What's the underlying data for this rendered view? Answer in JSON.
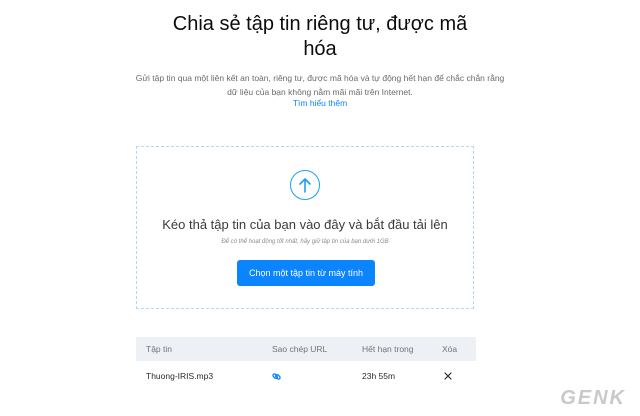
{
  "page": {
    "title": "Chia sẻ tập tin riêng tư, được mã hóa",
    "description": "Gửi tập tin qua một liên kết an toàn, riêng tư, được mã hóa và tự động hết hạn để chắc chắn rằng dữ liệu của bạn không nằm mãi mãi trên Internet.",
    "learn_more": "Tìm hiểu thêm"
  },
  "upload": {
    "icon": "upload-arrow-icon",
    "drop_title": "Kéo thả tập tin của bạn vào đây và bắt đầu tải lên",
    "drop_hint": "Để có thể hoạt động tốt nhất, hãy giữ tập tin của bạn dưới 1GB",
    "button_label": "Chọn một tập tin từ máy tính",
    "accent": "#0a84ff"
  },
  "files": {
    "headers": [
      "Tập tin",
      "Sao chép URL",
      "Hết hạn trong",
      "Xóa"
    ],
    "rows": [
      {
        "name": "Thuong-IRIS.mp3",
        "copy_icon": "link-icon",
        "expires": "23h 55m",
        "delete_icon": "close-icon"
      }
    ]
  },
  "watermark": "GENK"
}
